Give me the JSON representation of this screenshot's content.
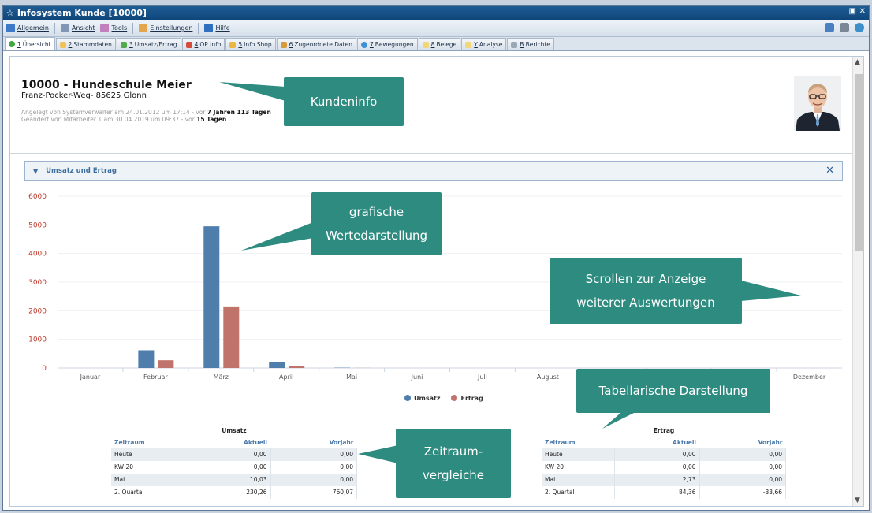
{
  "window": {
    "title": "Infosystem Kunde [10000]"
  },
  "menu": [
    {
      "label": "Allgemein",
      "icon": "arrow-icon",
      "color": "#3d78c9"
    },
    {
      "label": "Ansicht",
      "icon": "view-icon",
      "color": "#7f97b5"
    },
    {
      "label": "Tools",
      "icon": "tools-icon",
      "color": "#c27fbe"
    },
    {
      "label": "Einstellungen",
      "icon": "settings-icon",
      "color": "#e3a64a"
    },
    {
      "label": "Hilfe",
      "icon": "help-icon",
      "color": "#2f6fc0"
    }
  ],
  "tabs": [
    {
      "num": "1",
      "label": "Übersicht",
      "color": "#3fa83f"
    },
    {
      "num": "2",
      "label": "Stammdaten",
      "color": "#f0c35a"
    },
    {
      "num": "3",
      "label": "Umsatz/Ertrag",
      "color": "#54a84e"
    },
    {
      "num": "4",
      "label": "OP Info",
      "color": "#d64b3c"
    },
    {
      "num": "5",
      "label": "Info Shop",
      "color": "#e9b643"
    },
    {
      "num": "6",
      "label": "Zugeordnete Daten",
      "color": "#d99a3c"
    },
    {
      "num": "7",
      "label": "Bewegungen",
      "color": "#3e8fd3"
    },
    {
      "num": "8",
      "label": "Belege",
      "color": "#f2d77a"
    },
    {
      "num": "Y",
      "label": "Analyse",
      "color": "#f2d77a"
    },
    {
      "num": "B",
      "label": "Berichte",
      "color": "#9aa8b8"
    }
  ],
  "customer": {
    "name": "10000 - Hundeschule Meier",
    "address": "Franz-Pocker-Weg- 85625 Glonn",
    "created_prefix": "Angelegt von Systemverwalter am 24.01.2012 um 17:14 - vor ",
    "created_age": "7 Jahren 113 Tagen",
    "changed_prefix": "Geändert von Mitarbeiter 1 am 30.04.2019 um 09:37 - vor ",
    "changed_age": "15 Tagen"
  },
  "panel": {
    "title": "Umsatz und Ertrag"
  },
  "chart_data": {
    "type": "bar",
    "categories": [
      "Januar",
      "Februar",
      "März",
      "April",
      "Mai",
      "Juni",
      "Juli",
      "August",
      "September",
      "Oktober",
      "November",
      "Dezember"
    ],
    "series": [
      {
        "name": "Umsatz",
        "color": "#4f7eac",
        "values": [
          0,
          620,
          4950,
          200,
          10,
          0,
          0,
          0,
          0,
          0,
          0,
          0
        ]
      },
      {
        "name": "Ertrag",
        "color": "#c0736a",
        "values": [
          0,
          270,
          2150,
          80,
          3,
          0,
          0,
          0,
          0,
          0,
          0,
          0
        ]
      }
    ],
    "yticks": [
      0,
      1000,
      2000,
      3000,
      4000,
      5000,
      6000
    ],
    "ylim": [
      0,
      6000
    ],
    "legend": "bottom",
    "grid": true
  },
  "umsatz_table": {
    "title": "Umsatz",
    "headers": [
      "Zeitraum",
      "Aktuell",
      "Vorjahr"
    ],
    "rows": [
      [
        "Heute",
        "0,00",
        "0,00"
      ],
      [
        "KW 20",
        "0,00",
        "0,00"
      ],
      [
        "Mai",
        "10,03",
        "0,00"
      ],
      [
        "2. Quartal",
        "230,26",
        "760,07"
      ]
    ]
  },
  "ertrag_table": {
    "title": "Ertrag",
    "headers": [
      "Zeitraum",
      "Aktuell",
      "Vorjahr"
    ],
    "rows": [
      [
        "Heute",
        "0,00",
        "0,00"
      ],
      [
        "KW 20",
        "0,00",
        "0,00"
      ],
      [
        "Mai",
        "2,73",
        "0,00"
      ],
      [
        "2. Quartal",
        "84,36",
        "-33,66"
      ]
    ]
  },
  "callouts": {
    "kundeninfo": "Kundeninfo",
    "grafik": "grafische Wertedarstellung",
    "scroll": "Scrollen zur Anzeige weiterer Auswertungen",
    "tabelle": "Tabellarische Darstellung",
    "zeitraum": "Zeitraum- vergleiche"
  },
  "colors": {
    "accent": "#2e8b80",
    "titlebar": "#0f467a"
  }
}
